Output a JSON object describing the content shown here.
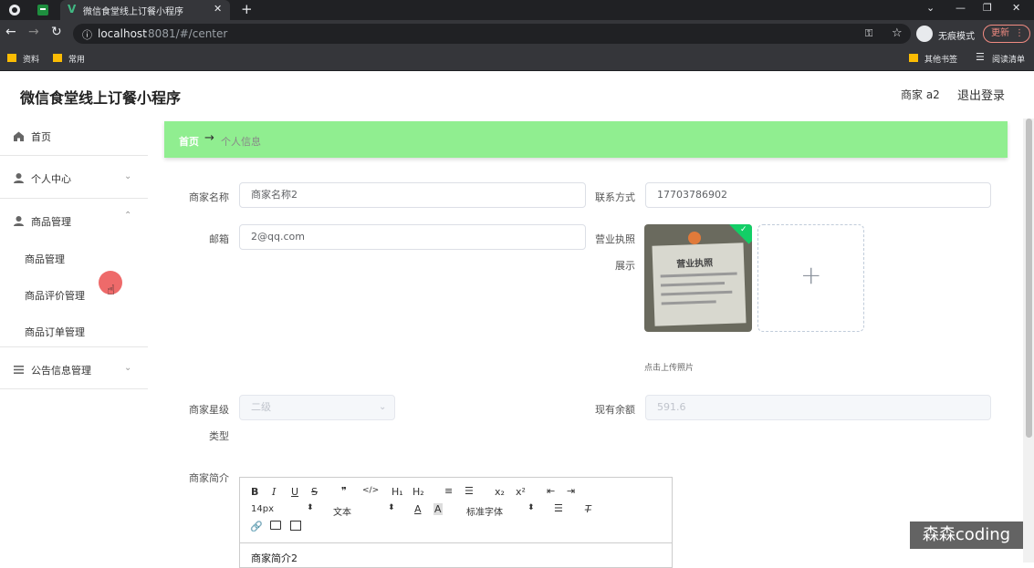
{
  "browser": {
    "tab_title": "微信食堂线上订餐小程序",
    "new_tab": "+",
    "url_host": "localhost",
    "url_rest": ":8081/#/center",
    "incognito_label": "无痕模式",
    "update_label": "更新",
    "bookmarks": [
      "资料",
      "常用"
    ],
    "other_bookmarks": "其他书签",
    "reading_list": "阅读清单"
  },
  "header": {
    "title": "微信食堂线上订餐小程序",
    "user": "商家 a2",
    "logout": "退出登录"
  },
  "sidebar": {
    "home": "首页",
    "personal": "个人中心",
    "goods_mgmt": "商品管理",
    "goods_sub": [
      "商品管理",
      "商品评价管理",
      "商品订单管理"
    ],
    "notice": "公告信息管理"
  },
  "breadcrumb": {
    "home": "首页",
    "separator": "→",
    "current": "个人信息"
  },
  "form": {
    "merchant_name_label": "商家名称",
    "merchant_name_value": "商家名称2",
    "contact_label": "联系方式",
    "contact_value": "17703786902",
    "email_label": "邮箱",
    "email_value": "2@qq.com",
    "license_label_1": "营业执照",
    "license_label_2": "展示",
    "upload_plus": "+",
    "upload_hint": "点击上传照片",
    "star_label_1": "商家星级",
    "star_label_2": "类型",
    "star_value": "二级",
    "balance_label": "现有余额",
    "balance_value": "591.6",
    "intro_label": "商家简介",
    "license_card_text": "营业执照"
  },
  "editor": {
    "row1": [
      "B",
      "I",
      "U",
      "S",
      "❞",
      "</>",
      "H₁",
      "H₂",
      "≡",
      "☰",
      "x₂",
      "x²",
      "⇤",
      "⇥"
    ],
    "font_size": "14px",
    "text_type": "文本",
    "font_family": "标准字体",
    "content": "商家简介2"
  },
  "watermark": "森森coding",
  "colors": {
    "breadcrumb_bg": "#90ee90",
    "chrome_dark": "#202124",
    "update_red": "#f28b82"
  }
}
